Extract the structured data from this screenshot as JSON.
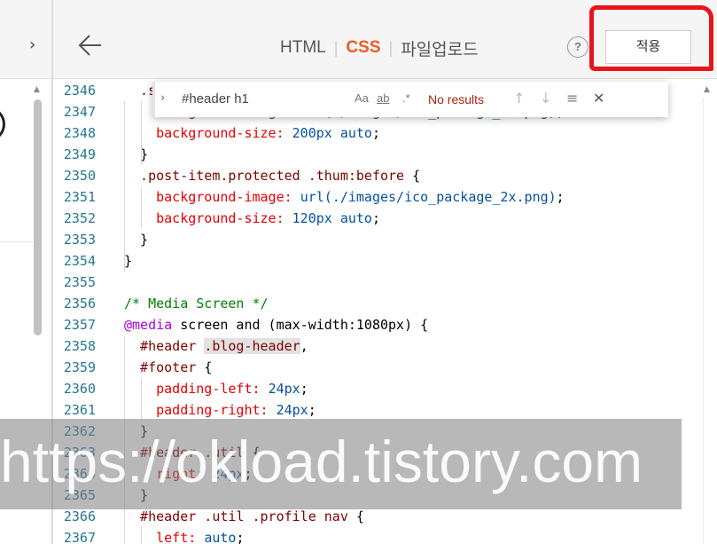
{
  "topbar": {
    "tabs": [
      {
        "label": "HTML",
        "active": false
      },
      {
        "label": "CSS",
        "active": true
      },
      {
        "label": "파일업로드",
        "active": false
      }
    ],
    "separator": "|",
    "help_label": "?",
    "apply_label": "적용"
  },
  "find": {
    "query": "#header h1",
    "match_case_label": "Aa",
    "whole_word_label": "ab",
    "regex_label": ".*",
    "result": "No results"
  },
  "editor": {
    "lines": [
      {
        "number": "2346",
        "tokens": [
          {
            "t": "  .sideba",
            "c": "sel"
          }
        ]
      },
      {
        "number": "2347",
        "tokens": [
          {
            "t": "    backgr",
            "c": "prop"
          },
          {
            "t": "ound-image: ",
            "c": "prop"
          },
          {
            "t": "url(./images/ico_package_2x.png);",
            "c": "val"
          }
        ]
      },
      {
        "number": "2348",
        "tokens": [
          {
            "t": "    background-size: ",
            "c": "prop"
          },
          {
            "t": "200px auto",
            "c": "val"
          },
          {
            "t": ";",
            "c": "plain"
          }
        ]
      },
      {
        "number": "2349",
        "tokens": [
          {
            "t": "  }",
            "c": "plain"
          }
        ]
      },
      {
        "number": "2350",
        "tokens": [
          {
            "t": "  .post-item.protected .thum:before ",
            "c": "sel"
          },
          {
            "t": "{",
            "c": "plain"
          }
        ]
      },
      {
        "number": "2351",
        "tokens": [
          {
            "t": "    background-image: ",
            "c": "prop"
          },
          {
            "t": "url(./images/ico_package_2x.png)",
            "c": "val"
          },
          {
            "t": ";",
            "c": "plain"
          }
        ]
      },
      {
        "number": "2352",
        "tokens": [
          {
            "t": "    background-size: ",
            "c": "prop"
          },
          {
            "t": "120px auto",
            "c": "val"
          },
          {
            "t": ";",
            "c": "plain"
          }
        ]
      },
      {
        "number": "2353",
        "tokens": [
          {
            "t": "  }",
            "c": "plain"
          }
        ]
      },
      {
        "number": "2354",
        "tokens": [
          {
            "t": "}",
            "c": "plain"
          }
        ]
      },
      {
        "number": "2355",
        "tokens": []
      },
      {
        "number": "2356",
        "tokens": [
          {
            "t": "/* Media Screen */",
            "c": "comm"
          }
        ]
      },
      {
        "number": "2357",
        "tokens": [
          {
            "t": "@media",
            "c": "at"
          },
          {
            "t": " screen and (max-width:1080px) {",
            "c": "plain"
          }
        ]
      },
      {
        "number": "2358",
        "tokens": [
          {
            "t": "  #header ",
            "c": "sel"
          },
          {
            "t": ".blog-header",
            "c": "sel",
            "hl": true
          },
          {
            "t": ",",
            "c": "plain"
          }
        ]
      },
      {
        "number": "2359",
        "tokens": [
          {
            "t": "  #footer ",
            "c": "sel"
          },
          {
            "t": "{",
            "c": "plain"
          }
        ]
      },
      {
        "number": "2360",
        "tokens": [
          {
            "t": "    padding-left: ",
            "c": "prop"
          },
          {
            "t": "24px",
            "c": "val"
          },
          {
            "t": ";",
            "c": "plain"
          }
        ]
      },
      {
        "number": "2361",
        "tokens": [
          {
            "t": "    padding-right: ",
            "c": "prop"
          },
          {
            "t": "24px",
            "c": "val"
          },
          {
            "t": ";",
            "c": "plain"
          }
        ]
      },
      {
        "number": "2362",
        "tokens": [
          {
            "t": "  }",
            "c": "plain"
          }
        ]
      },
      {
        "number": "2363",
        "tokens": [
          {
            "t": "  #header .util ",
            "c": "sel"
          },
          {
            "t": "{",
            "c": "plain"
          }
        ]
      },
      {
        "number": "2364",
        "tokens": [
          {
            "t": "    right: ",
            "c": "prop"
          },
          {
            "t": "24px",
            "c": "val"
          },
          {
            "t": ";",
            "c": "plain"
          }
        ]
      },
      {
        "number": "2365",
        "tokens": [
          {
            "t": "  }",
            "c": "plain"
          }
        ]
      },
      {
        "number": "2366",
        "tokens": [
          {
            "t": "  #header .util .profile nav ",
            "c": "sel"
          },
          {
            "t": "{",
            "c": "plain"
          }
        ]
      },
      {
        "number": "2367",
        "tokens": [
          {
            "t": "    left: ",
            "c": "prop"
          },
          {
            "t": "auto",
            "c": "val"
          },
          {
            "t": ";",
            "c": "plain"
          }
        ]
      }
    ]
  },
  "watermark": {
    "text": "https://okload.tistory.com"
  },
  "colors": {
    "accent": "#ef5a22",
    "annotation_red": "#e8141c",
    "line_number": "#237893",
    "selector": "#800000",
    "property": "#e50000",
    "value": "#0451a5",
    "at_rule": "#af00db",
    "comment": "#008000",
    "no_results": "#a1260d"
  },
  "icons": {
    "back": "arrow-left-icon",
    "collapse": "chevron-right-icon",
    "help": "question-circle-icon",
    "find_toggle": "chevron-right-icon",
    "prev": "arrow-up-icon",
    "next": "arrow-down-icon",
    "selection": "find-in-selection-icon",
    "close": "close-icon"
  }
}
